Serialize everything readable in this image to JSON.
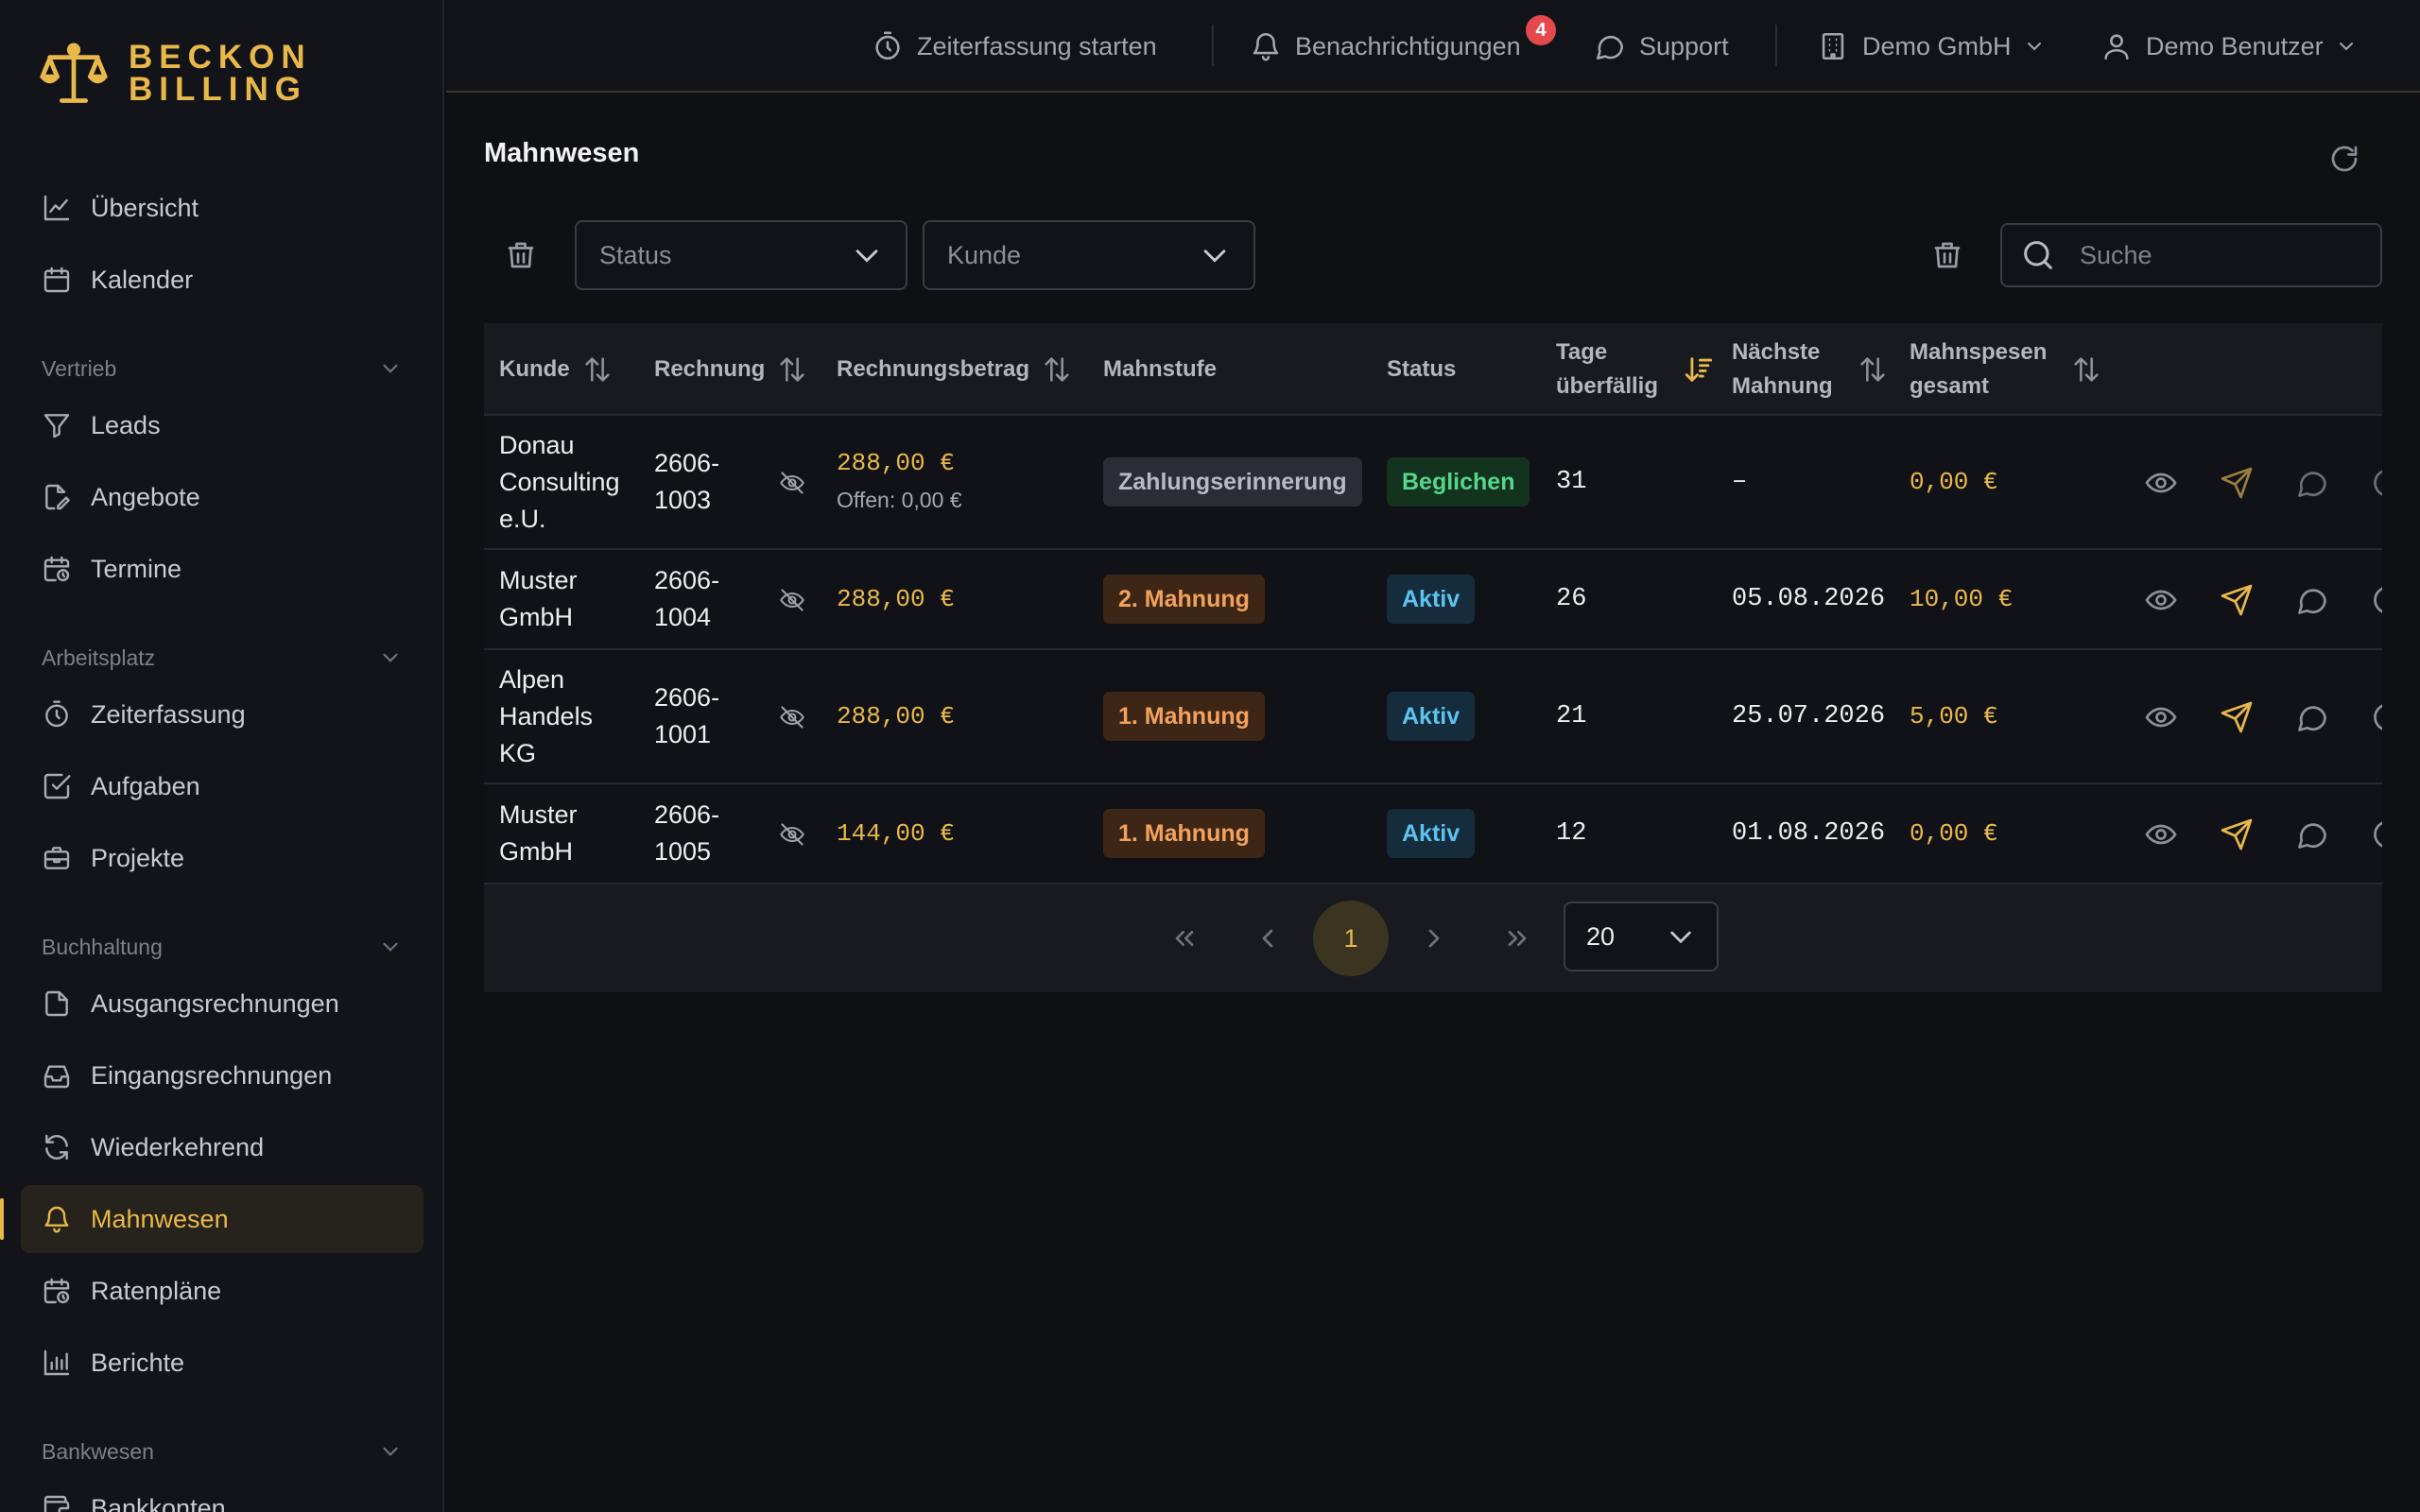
{
  "brand": {
    "line1": "BECKON",
    "line2": "BILLING",
    "accent": "#e9b84b"
  },
  "sidebar": {
    "top": [
      {
        "label": "Übersicht",
        "icon": "chart-line-icon"
      },
      {
        "label": "Kalender",
        "icon": "calendar-icon"
      }
    ],
    "sections": [
      {
        "title": "Vertrieb",
        "items": [
          {
            "label": "Leads",
            "icon": "funnel-icon"
          },
          {
            "label": "Angebote",
            "icon": "file-edit-icon"
          },
          {
            "label": "Termine",
            "icon": "calendar-clock-icon"
          }
        ]
      },
      {
        "title": "Arbeitsplatz",
        "items": [
          {
            "label": "Zeiterfassung",
            "icon": "timer-icon"
          },
          {
            "label": "Aufgaben",
            "icon": "checkbox-icon"
          },
          {
            "label": "Projekte",
            "icon": "briefcase-icon"
          }
        ]
      },
      {
        "title": "Buchhaltung",
        "items": [
          {
            "label": "Ausgangsrechnungen",
            "icon": "file-icon"
          },
          {
            "label": "Eingangsrechnungen",
            "icon": "inbox-icon"
          },
          {
            "label": "Wiederkehrend",
            "icon": "refresh-icon"
          },
          {
            "label": "Mahnwesen",
            "icon": "bell-icon",
            "active": true
          },
          {
            "label": "Ratenpläne",
            "icon": "calendar-clock-icon"
          },
          {
            "label": "Berichte",
            "icon": "bar-chart-icon"
          }
        ]
      },
      {
        "title": "Bankwesen",
        "items": [
          {
            "label": "Bankkonten",
            "icon": "wallet-icon"
          }
        ]
      }
    ]
  },
  "topbar": {
    "timer": "Zeiterfassung starten",
    "notifications": "Benachrichtigungen",
    "notification_count": "4",
    "support": "Support",
    "company": "Demo GmbH",
    "user": "Demo Benutzer"
  },
  "page": {
    "title": "Mahnwesen"
  },
  "filters": {
    "status_placeholder": "Status",
    "customer_placeholder": "Kunde",
    "search_placeholder": "Suche"
  },
  "table": {
    "columns": {
      "customer": "Kunde",
      "invoice": "Rechnung",
      "amount": "Rechnungsbetrag",
      "level": "Mahnstufe",
      "status": "Status",
      "days_overdue": "Tage überfällig",
      "next_reminder": "Nächste Mahnung",
      "fees_total": "Mahnspesen gesamt"
    },
    "rows": [
      {
        "customer": "Donau Consulting e.U.",
        "invoice": "2606-1003",
        "amount": "288,00 €",
        "open": "Offen: 0,00 €",
        "level": "Zahlungserinnerung",
        "level_style": "gray",
        "status": "Beglichen",
        "status_style": "green",
        "days": "31",
        "next": "–",
        "fees": "0,00 €"
      },
      {
        "customer": "Muster GmbH",
        "invoice": "2606-1004",
        "amount": "288,00 €",
        "open": "",
        "level": "2. Mahnung",
        "level_style": "orange",
        "status": "Aktiv",
        "status_style": "blue",
        "days": "26",
        "next": "05.08.2026",
        "fees": "10,00 €"
      },
      {
        "customer": "Alpen Handels KG",
        "invoice": "2606-1001",
        "amount": "288,00 €",
        "open": "",
        "level": "1. Mahnung",
        "level_style": "orange",
        "status": "Aktiv",
        "status_style": "blue",
        "days": "21",
        "next": "25.07.2026",
        "fees": "5,00 €"
      },
      {
        "customer": "Muster GmbH",
        "invoice": "2606-1005",
        "amount": "144,00 €",
        "open": "",
        "level": "1. Mahnung",
        "level_style": "orange",
        "status": "Aktiv",
        "status_style": "blue",
        "days": "12",
        "next": "01.08.2026",
        "fees": "0,00 €"
      }
    ]
  },
  "pagination": {
    "current": "1",
    "page_size": "20"
  }
}
